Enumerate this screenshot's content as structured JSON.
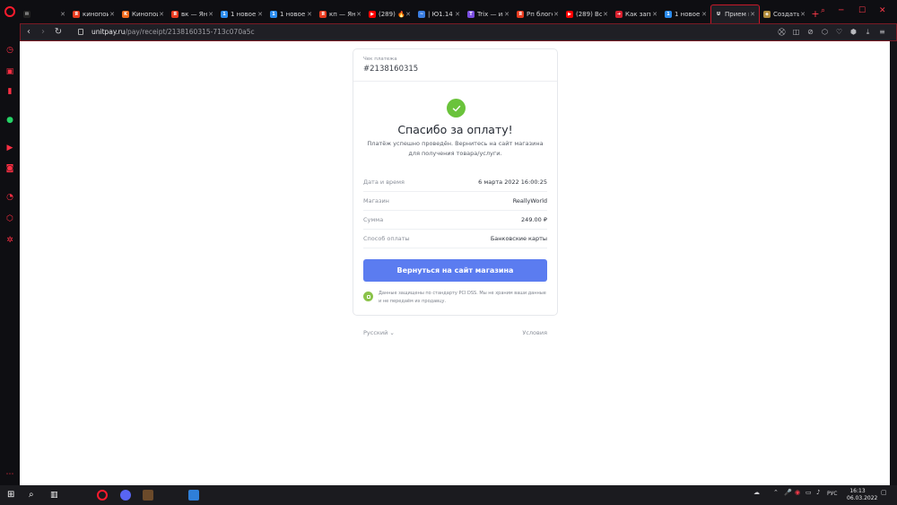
{
  "tabs": [
    {
      "label": "",
      "fav_color": "#222",
      "fav_text": "✉"
    },
    {
      "label": "кинопоиск",
      "fav_color": "#e83a1e",
      "fav_text": "Я"
    },
    {
      "label": "Кинопоиск",
      "fav_color": "#f26a1b",
      "fav_text": "K"
    },
    {
      "label": "вк — Ян",
      "fav_color": "#e83a1e",
      "fav_text": "Я"
    },
    {
      "label": "1 новое",
      "fav_color": "#2a8cf0",
      "fav_text": "1"
    },
    {
      "label": "1 новое с",
      "fav_color": "#2a8cf0",
      "fav_text": "1"
    },
    {
      "label": "кп — Ян",
      "fav_color": "#e83a1e",
      "fav_text": "Я"
    },
    {
      "label": "(289) 🔥",
      "fav_color": "#ff0000",
      "fav_text": "▶"
    },
    {
      "label": "| Ю1.14",
      "fav_color": "#3a7de0",
      "fav_text": "~"
    },
    {
      "label": "Trix — игр",
      "fav_color": "#7a4de0",
      "fav_text": "T"
    },
    {
      "label": "Рп блогер",
      "fav_color": "#e83a1e",
      "fav_text": "Я"
    },
    {
      "label": "(289) Вся",
      "fav_color": "#ff0000",
      "fav_text": "▶"
    },
    {
      "label": "Как запи",
      "fav_color": "#d9202e",
      "fav_text": "➜"
    },
    {
      "label": "1 новое с",
      "fav_color": "#2a8cf0",
      "fav_text": "1"
    },
    {
      "label": "Прием п",
      "fav_color": "#1f1f25",
      "fav_text": "U",
      "active": true
    },
    {
      "label": "Создать",
      "fav_color": "#b08a3a",
      "fav_text": "◈"
    }
  ],
  "address": {
    "domain": "unitpay.ru",
    "path": "/pay/receipt/2138160315-713c070a5c"
  },
  "receipt": {
    "label": "Чек платежа",
    "number": "#2138160315",
    "thanks": "Спасибо за оплату!",
    "subtitle": "Платёж успешно проведён. Вернитесь на сайт магазина для получения товара/услуги.",
    "rows": [
      {
        "key": "Дата и время",
        "value": "6 марта 2022 16:00:25"
      },
      {
        "key": "Магазин",
        "value": "ReallyWorld"
      },
      {
        "key": "Сумма",
        "value": "249.00 ₽"
      },
      {
        "key": "Способ оплаты",
        "value": "Банковские карты"
      }
    ],
    "button": "Вернуться на сайт магазина",
    "secure_text": "Данные защищены по стандарту PCI DSS. Мы не храним ваши данные и не передаём их продавцу."
  },
  "footer": {
    "language": "Русский",
    "terms": "Условия"
  },
  "taskbar": {
    "lang": "РУС",
    "time": "16:13",
    "date": "06.03.2022"
  },
  "colors": {
    "accent_button": "#5b7cf0",
    "success": "#6ac33b",
    "opera_red": "#ff1b2d"
  }
}
